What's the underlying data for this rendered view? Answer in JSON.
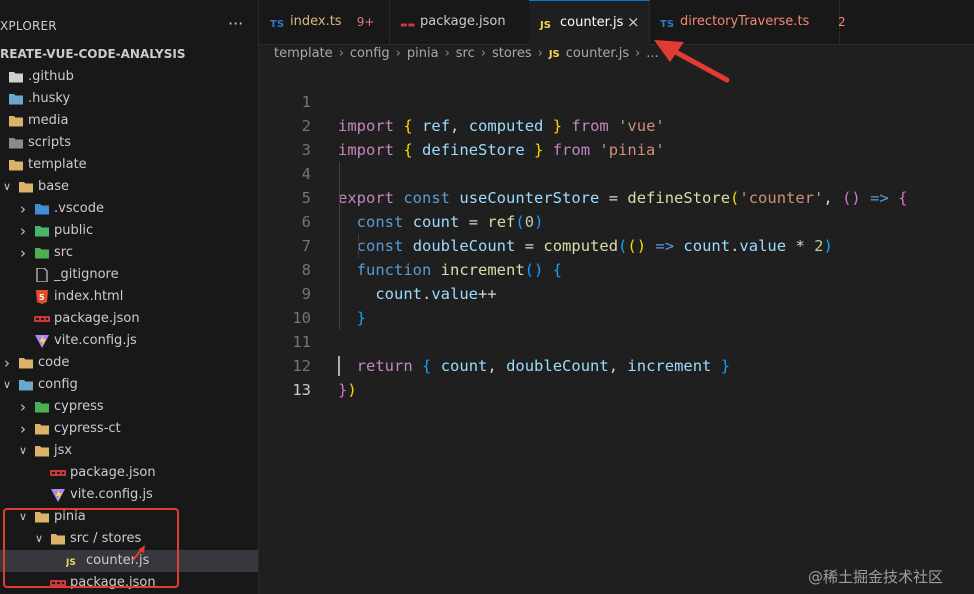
{
  "explorer": {
    "title": "XPLORER",
    "more": "···",
    "root": "REATE-VUE-CODE-ANALYSIS"
  },
  "tree": [
    {
      "label": ".github",
      "chev": "",
      "icon": "github-folder-icon",
      "color": "#cfcfcf",
      "level": 0
    },
    {
      "label": ".husky",
      "chev": "",
      "icon": "husky-folder-icon",
      "color": "#6aa9c9",
      "level": 0
    },
    {
      "label": "media",
      "chev": "",
      "icon": "folder-icon",
      "color": "#d8b36a",
      "level": 0
    },
    {
      "label": "scripts",
      "chev": "",
      "icon": "scripts-folder-icon",
      "color": "#8b8b8b",
      "level": 0
    },
    {
      "label": "template",
      "chev": "",
      "icon": "folder-open-icon",
      "color": "#d8b36a",
      "level": 0
    },
    {
      "label": "base",
      "chev": "v",
      "icon": "folder-open-icon",
      "color": "#d8b36a",
      "level": 1
    },
    {
      "label": ".vscode",
      "chev": ">",
      "icon": "vscode-folder-icon",
      "color": "#3f8fd6",
      "level": 2
    },
    {
      "label": "public",
      "chev": ">",
      "icon": "public-folder-icon",
      "color": "#4bb36b",
      "level": 2
    },
    {
      "label": "src",
      "chev": ">",
      "icon": "src-folder-icon",
      "color": "#4caf50",
      "level": 2
    },
    {
      "label": "_gitignore",
      "chev": "",
      "icon": "file-icon",
      "color": "#cccccc",
      "level": 2
    },
    {
      "label": "index.html",
      "chev": "",
      "icon": "html-file-icon",
      "color": "#e44d26",
      "level": 2
    },
    {
      "label": "package.json",
      "chev": "",
      "icon": "npm-file-icon",
      "color": "#cb3837",
      "level": 2
    },
    {
      "label": "vite.config.js",
      "chev": "",
      "icon": "vite-file-icon",
      "color": "#a98bff",
      "level": 2
    },
    {
      "label": "code",
      "chev": ">",
      "icon": "folder-icon",
      "color": "#d8b36a",
      "level": 1
    },
    {
      "label": "config",
      "chev": "v",
      "icon": "config-folder-icon",
      "color": "#6aa9c9",
      "level": 1
    },
    {
      "label": "cypress",
      "chev": ">",
      "icon": "cypress-folder-icon",
      "color": "#4caf50",
      "level": 2
    },
    {
      "label": "cypress-ct",
      "chev": ">",
      "icon": "folder-icon",
      "color": "#d8b36a",
      "level": 2
    },
    {
      "label": "jsx",
      "chev": "v",
      "icon": "folder-open-icon",
      "color": "#d8b36a",
      "level": 2
    },
    {
      "label": "package.json",
      "chev": "",
      "icon": "npm-file-icon",
      "color": "#cb3837",
      "level": 3
    },
    {
      "label": "vite.config.js",
      "chev": "",
      "icon": "vite-file-icon",
      "color": "#a98bff",
      "level": 3
    },
    {
      "label": "pinia",
      "chev": "v",
      "icon": "folder-open-icon",
      "color": "#d8b36a",
      "level": 2
    },
    {
      "label": "src / stores",
      "chev": "v",
      "icon": "folder-open-icon",
      "color": "#d8b36a",
      "level": 3
    },
    {
      "label": "counter.js",
      "chev": "",
      "icon": "js-file-icon",
      "color": "#f0db4f",
      "level": 4,
      "selected": true
    },
    {
      "label": "package.json",
      "chev": "",
      "icon": "npm-file-icon",
      "color": "#cb3837",
      "level": 3
    }
  ],
  "tabs": [
    {
      "icon": "TS",
      "icon_color": "#3178c6",
      "name": "index.ts",
      "name_color": "#d7ba7d",
      "badge": "9+",
      "badge_color": "#e07b7b"
    },
    {
      "icon": "npm",
      "icon_color": "#cb3837",
      "name": "package.json",
      "name_color": "#cccccc",
      "badge": "",
      "badge_color": ""
    },
    {
      "icon": "JS",
      "icon_color": "#f0db4f",
      "name": "counter.js",
      "name_color": "#ffffff",
      "badge": "",
      "badge_color": "",
      "active": true,
      "close": "×"
    },
    {
      "icon": "TS",
      "icon_color": "#3178c6",
      "name": "directoryTraverse.ts",
      "name_color": "#f48771",
      "badge": "2",
      "badge_color": "#f48771"
    }
  ],
  "breadcrumb": [
    "template",
    "config",
    "pinia",
    "src",
    "stores",
    "counter.js",
    "..."
  ],
  "breadcrumb_js_icon": "JS",
  "editor": {
    "line_numbers": [
      "1",
      "2",
      "3",
      "4",
      "5",
      "6",
      "7",
      "8",
      "9",
      "10",
      "11",
      "12",
      "13"
    ],
    "current_line": "13"
  },
  "watermark": "@稀土掘金技术社区",
  "colors": {
    "annotation": "#e23b33",
    "accent": "#0078d4",
    "editor_bg": "#1f1f1f",
    "sidebar_bg": "#181818"
  }
}
